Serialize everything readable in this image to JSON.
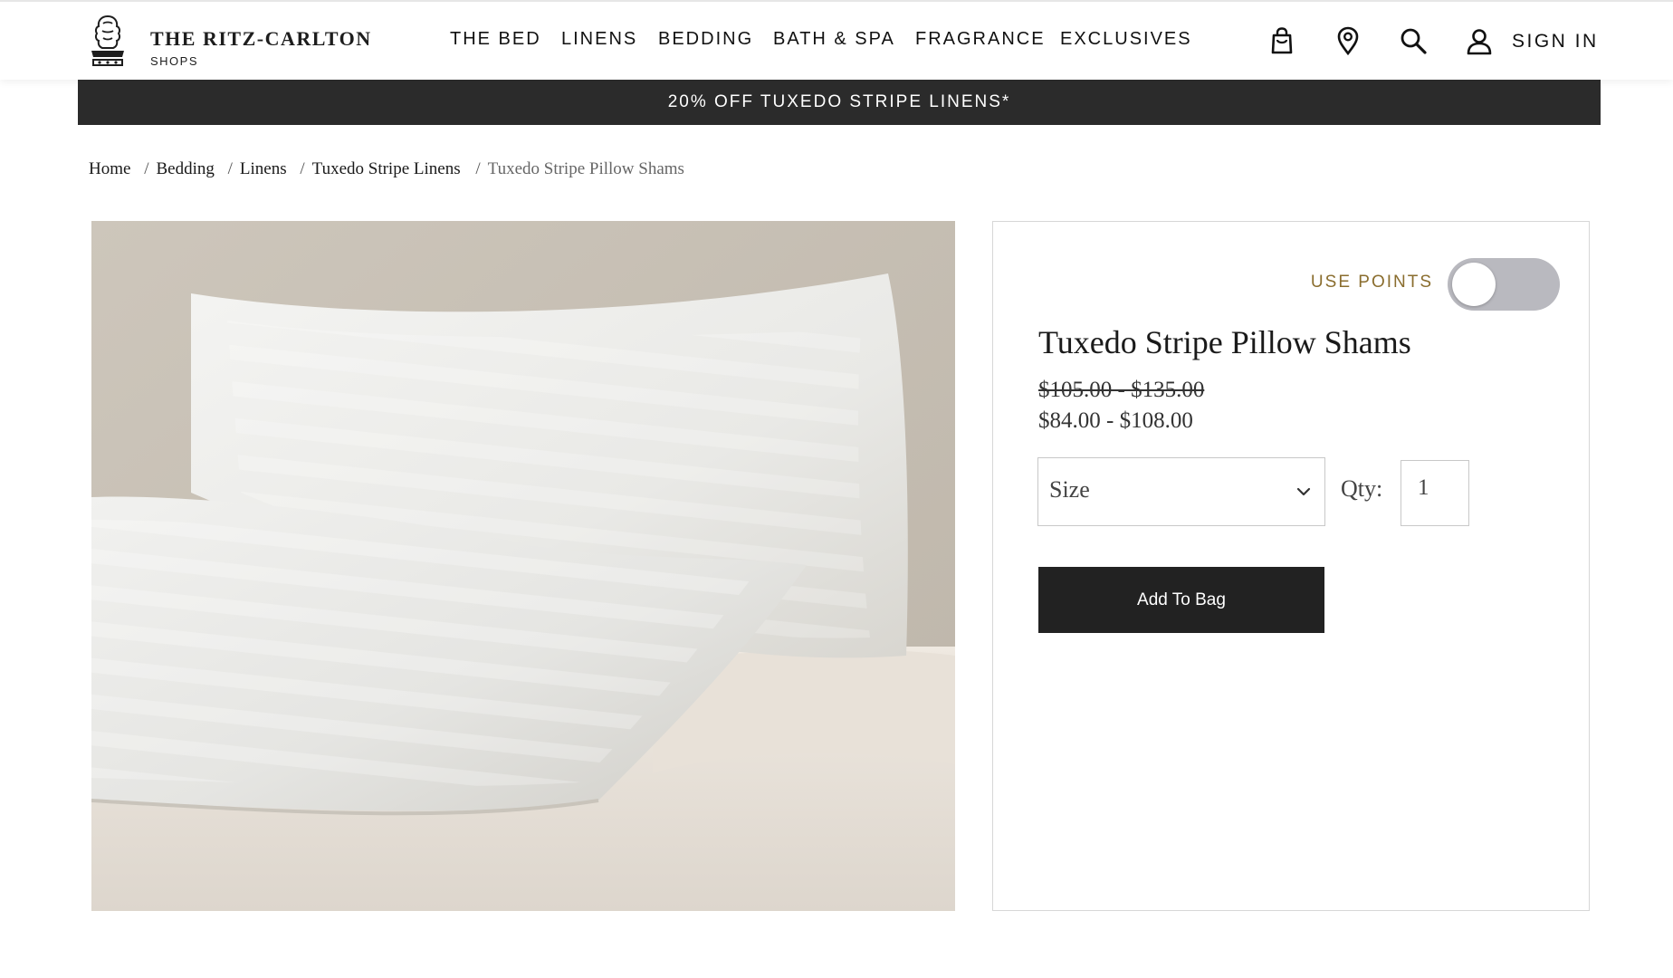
{
  "header": {
    "brand_name": "THE RITZ-CARLTON",
    "brand_sub": "SHOPS",
    "nav": [
      "THE BED",
      "LINENS",
      "BEDDING",
      "BATH & SPA",
      "FRAGRANCE",
      "EXCLUSIVES"
    ],
    "icons": [
      "shopping-bag-icon",
      "location-pin-icon",
      "search-icon",
      "user-icon"
    ],
    "sign_in": "SIGN IN"
  },
  "promo": {
    "text": "20% OFF TUXEDO STRIPE LINENS*"
  },
  "breadcrumb": {
    "items": [
      "Home",
      "Bedding",
      "Linens",
      "Tuxedo Stripe Linens"
    ],
    "current": "Tuxedo Stripe Pillow Shams"
  },
  "product": {
    "use_points_label": "USE POINTS",
    "use_points_enabled": false,
    "title": "Tuxedo Stripe Pillow Shams",
    "original_price": "$105.00 - $135.00",
    "sale_price": "$84.00 - $108.00",
    "size_label": "Size",
    "qty_label": "Qty:",
    "qty_value": "1",
    "add_to_bag": "Add To Bag"
  },
  "colors": {
    "promo_bg": "#2b2b2b",
    "points_gold": "#8a6d2e",
    "button_bg": "#222222",
    "toggle_off": "#b9b9bf"
  }
}
